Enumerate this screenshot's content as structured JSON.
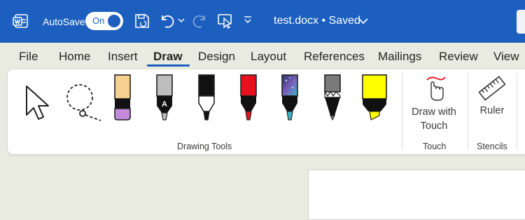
{
  "titlebar": {
    "app_icon": "word-icon",
    "autosave_label": "AutoSave",
    "autosave_state": "On",
    "doc_title": "test.docx • Saved",
    "bar_color": "#1d5fbf"
  },
  "tabs": [
    {
      "label": "File"
    },
    {
      "label": "Home"
    },
    {
      "label": "Insert"
    },
    {
      "label": "Draw",
      "active": true
    },
    {
      "label": "Design"
    },
    {
      "label": "Layout"
    },
    {
      "label": "References"
    },
    {
      "label": "Mailings"
    },
    {
      "label": "Review"
    },
    {
      "label": "View"
    }
  ],
  "ribbon": {
    "groups": [
      {
        "label": "Drawing Tools",
        "tools": [
          {
            "icon": "select-pointer-icon"
          },
          {
            "icon": "lasso-select-icon"
          },
          {
            "icon": "eraser-icon"
          },
          {
            "icon": "pen-icon"
          },
          {
            "icon": "pen-icon",
            "color": "#000000"
          },
          {
            "icon": "pen-icon",
            "color": "#e8101c"
          },
          {
            "icon": "galaxy-pen-icon"
          },
          {
            "icon": "pencil-icon"
          },
          {
            "icon": "highlighter-icon",
            "color": "#ffff00"
          }
        ]
      },
      {
        "label": "Touch",
        "button": "Draw with Touch",
        "icon": "touch-draw-icon"
      },
      {
        "label": "Stencils",
        "button": "Ruler",
        "icon": "ruler-icon"
      }
    ]
  },
  "pen_label_A": "A"
}
